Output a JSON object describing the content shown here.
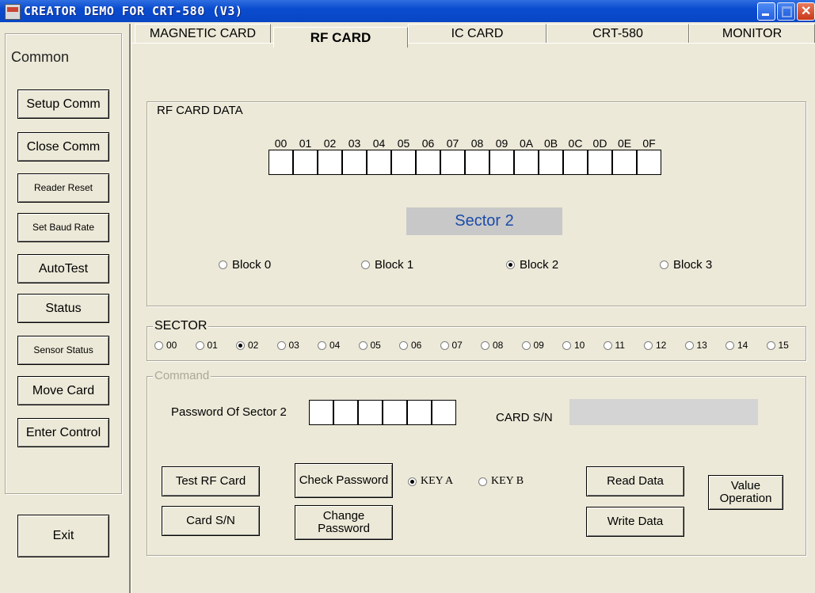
{
  "window": {
    "title": "CREATOR DEMO FOR CRT-580 (V3)"
  },
  "sidebar": {
    "group_label": "Common",
    "buttons": [
      "Setup Comm",
      "Close Comm",
      "Reader Reset",
      "Set Baud Rate",
      "AutoTest",
      "Status",
      "Sensor Status",
      "Move Card",
      "Enter Control"
    ],
    "exit_label": "Exit"
  },
  "tabs": [
    {
      "label": "MAGNETIC CARD",
      "active": false
    },
    {
      "label": "RF CARD",
      "active": true
    },
    {
      "label": "IC CARD",
      "active": false
    },
    {
      "label": "CRT-580",
      "active": false
    },
    {
      "label": "MONITOR",
      "active": false
    }
  ],
  "rf_data": {
    "group_label": "RF CARD DATA",
    "hex_headers": [
      "00",
      "01",
      "02",
      "03",
      "04",
      "05",
      "06",
      "07",
      "08",
      "09",
      "0A",
      "0B",
      "0C",
      "0D",
      "0E",
      "0F"
    ],
    "sector_display": "Sector 2",
    "blocks": [
      {
        "label": "Block 0",
        "checked": false
      },
      {
        "label": "Block 1",
        "checked": false
      },
      {
        "label": "Block 2",
        "checked": true
      },
      {
        "label": "Block 3",
        "checked": false
      }
    ]
  },
  "sector": {
    "group_label": "SECTOR",
    "options": [
      "00",
      "01",
      "02",
      "03",
      "04",
      "05",
      "06",
      "07",
      "08",
      "09",
      "10",
      "11",
      "12",
      "13",
      "14",
      "15"
    ],
    "selected": "02"
  },
  "command": {
    "group_label": "Command",
    "password_label": "Password Of Sector 2",
    "card_sn_label": "CARD S/N",
    "buttons": {
      "test_rf_card": "Test RF Card",
      "card_sn": "Card S/N",
      "check_password": "Check Password",
      "change_password": "Change Password",
      "read_data": "Read Data",
      "write_data": "Write Data",
      "value_operation": "Value Operation"
    },
    "key_a": "KEY A",
    "key_b": "KEY B",
    "key_selected": "KEY A"
  }
}
